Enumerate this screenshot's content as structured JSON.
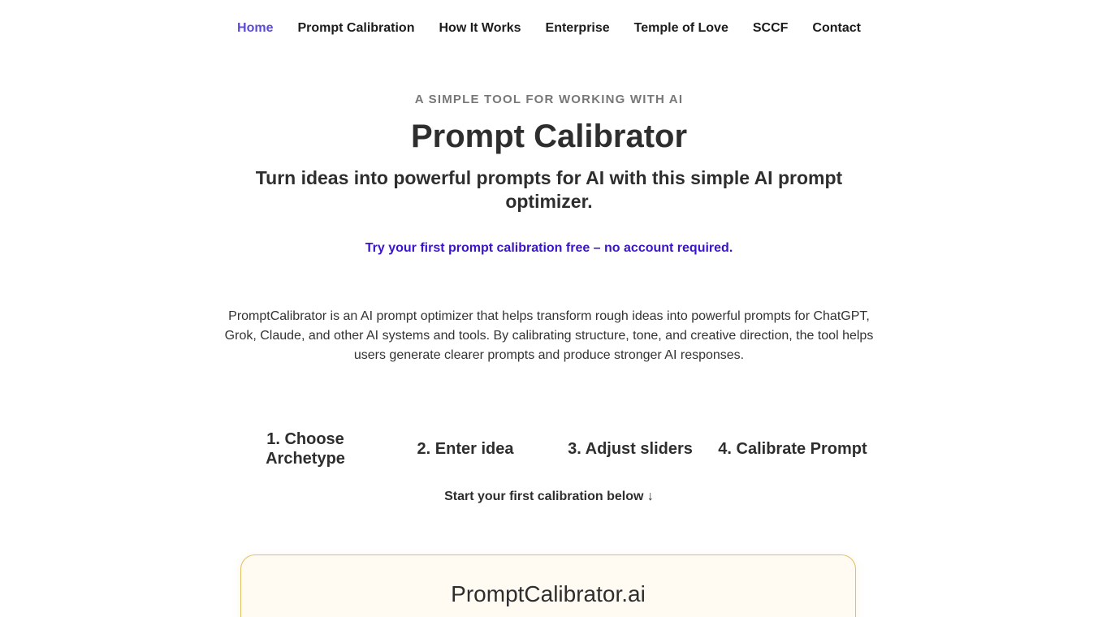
{
  "nav": {
    "items": [
      {
        "label": "Home",
        "active": true
      },
      {
        "label": "Prompt Calibration",
        "active": false
      },
      {
        "label": "How It Works",
        "active": false
      },
      {
        "label": "Enterprise",
        "active": false
      },
      {
        "label": "Temple of Love",
        "active": false
      },
      {
        "label": "SCCF",
        "active": false
      },
      {
        "label": "Contact",
        "active": false
      }
    ]
  },
  "hero": {
    "kicker": "A SIMPLE TOOL FOR WORKING WITH AI",
    "title": "Prompt Calibrator",
    "subtitle": "Turn ideas into powerful prompts for AI with this simple AI prompt optimizer.",
    "free_link": "Try your first prompt calibration free – no account required."
  },
  "description": "PromptCalibrator is an AI prompt optimizer that helps transform rough ideas into powerful prompts for ChatGPT, Grok, Claude, and other AI systems and tools. By calibrating structure, tone, and creative direction, the tool helps users generate clearer prompts and produce stronger AI responses.",
  "steps": [
    {
      "label": "1. Choose Archetype"
    },
    {
      "label": "2. Enter idea"
    },
    {
      "label": "3. Adjust sliders"
    },
    {
      "label": "4. Calibrate Prompt"
    }
  ],
  "start_cue": "Start your first calibration below ↓",
  "card": {
    "title": "PromptCalibrator.ai"
  },
  "colors": {
    "accent": "#5b4bd6",
    "link": "#3b13c9",
    "card_border": "#e2bf62",
    "card_background": "#fffbf3"
  }
}
